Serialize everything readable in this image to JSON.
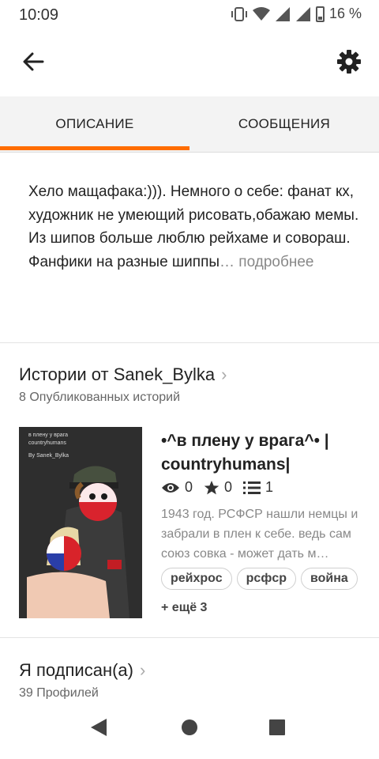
{
  "status_bar": {
    "time": "10:09",
    "battery_percent": "16 %"
  },
  "tabs": [
    {
      "label": "ОПИСАНИЕ",
      "active": true
    },
    {
      "label": "СООБЩЕНИЯ",
      "active": false
    }
  ],
  "description": {
    "text": "Хело мащафака:))). Немного о себе: фанат кх, художник не умеющий рисовать,обажаю мемы. Из шипов больше люблю рейхаме и совораш. Фанфики на разные шиппы",
    "ellipsis": "…",
    "more_label": " подробнее"
  },
  "stories_section": {
    "title": "Истории от Sanek_Bylka",
    "subtitle": "8 Опубликованных историй"
  },
  "story": {
    "cover_text_1": "в плену у врага",
    "cover_text_2": "countryhumans",
    "cover_text_3": "By Sanek_Bylka",
    "title": "•^в плену у врага^• | countryhumans|",
    "views": "0",
    "votes": "0",
    "parts": "1",
    "description": "1943 год. РСФСР нашли немцы и забрали в плен к себе. ведь сам союз совка - может дать м…",
    "tags": [
      "рейхрос",
      "рсфср",
      "война"
    ],
    "more_tags": "+ ещё 3"
  },
  "following_section": {
    "title": "Я подписан(а)",
    "subtitle": "39 Профилей"
  },
  "colors": {
    "accent": "#ff6d00"
  },
  "icons": [
    "back-arrow-icon",
    "gear-icon",
    "eye-icon",
    "star-icon",
    "list-icon",
    "chevron-right-icon",
    "nav-back-icon",
    "nav-home-icon",
    "nav-recents-icon"
  ]
}
